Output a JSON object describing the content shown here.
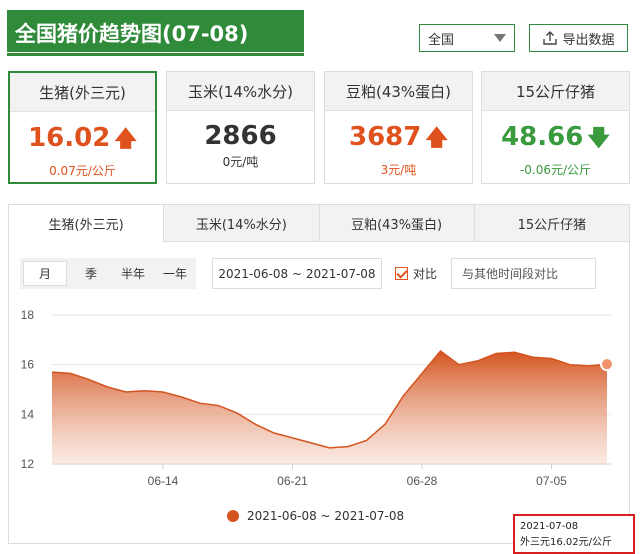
{
  "header": {
    "title": "全国猪价趋势图(07-08)",
    "region_select": "全国",
    "export_label": "导出数据"
  },
  "cards": [
    {
      "name": "生猪(外三元)",
      "value": "16.02",
      "trend": "up",
      "change": "0.07元/公斤"
    },
    {
      "name": "玉米(14%水分)",
      "value": "2866",
      "trend": "flat",
      "change": "0元/吨"
    },
    {
      "name": "豆粕(43%蛋白)",
      "value": "3687",
      "trend": "up",
      "change": "3元/吨"
    },
    {
      "name": "15公斤仔猪",
      "value": "48.66",
      "trend": "down",
      "change": "-0.06元/公斤"
    }
  ],
  "tabs": [
    "生猪(外三元)",
    "玉米(14%水分)",
    "豆粕(43%蛋白)",
    "15公斤仔猪"
  ],
  "period_buttons": [
    "月",
    "季",
    "半年",
    "一年"
  ],
  "date_range": "2021-06-08 ~ 2021-07-08",
  "compare": {
    "label": "对比",
    "placeholder": "与其他时间段对比"
  },
  "tooltip": {
    "date": "2021-07-08",
    "text": "外三元16.02元/公斤"
  },
  "colors": {
    "brand": "#2f8a3a",
    "up": "#e0521d",
    "down": "#3a9b3e",
    "series": "#d4541f"
  },
  "chart_data": {
    "type": "area",
    "x": [
      "2021-06-08",
      "2021-06-09",
      "2021-06-10",
      "2021-06-11",
      "2021-06-12",
      "2021-06-13",
      "2021-06-14",
      "2021-06-15",
      "2021-06-16",
      "2021-06-17",
      "2021-06-18",
      "2021-06-19",
      "2021-06-20",
      "2021-06-21",
      "2021-06-22",
      "2021-06-23",
      "2021-06-24",
      "2021-06-25",
      "2021-06-26",
      "2021-06-27",
      "2021-06-28",
      "2021-06-29",
      "2021-06-30",
      "2021-07-01",
      "2021-07-02",
      "2021-07-03",
      "2021-07-04",
      "2021-07-05",
      "2021-07-06",
      "2021-07-07",
      "2021-07-08"
    ],
    "values": [
      15.7,
      15.65,
      15.4,
      15.1,
      14.9,
      14.95,
      14.9,
      14.7,
      14.45,
      14.35,
      14.05,
      13.6,
      13.25,
      13.05,
      12.85,
      12.65,
      12.7,
      12.95,
      13.6,
      14.75,
      15.65,
      16.55,
      16.0,
      16.15,
      16.45,
      16.5,
      16.3,
      16.25,
      16.0,
      15.95,
      16.02
    ],
    "xticks": [
      "06-14",
      "06-21",
      "06-28",
      "07-05"
    ],
    "ylim": [
      12,
      18
    ],
    "yticks": [
      12,
      14,
      16,
      18
    ],
    "grid": true,
    "legend": "2021-06-08 ~ 2021-07-08",
    "legend_position": "bottom"
  }
}
